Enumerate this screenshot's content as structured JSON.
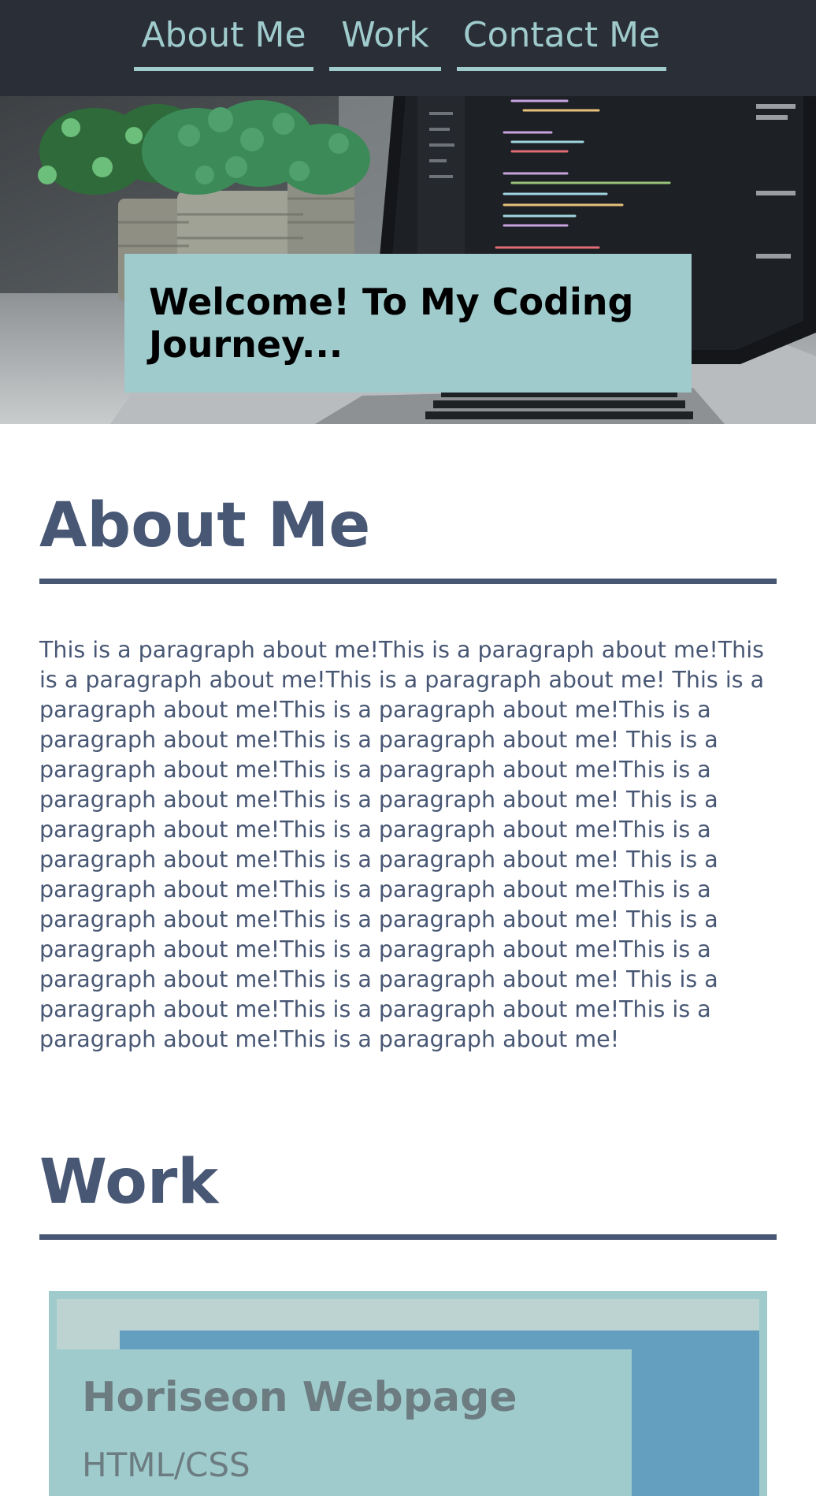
{
  "nav": {
    "about": "About Me",
    "work": "Work",
    "contact": "Contact Me"
  },
  "hero": {
    "title": "Welcome! To My Coding Journey...",
    "image_icon": "laptop-with-plants-photo"
  },
  "about": {
    "heading": "About Me",
    "paragraph": "This is a paragraph about me!This is a paragraph about me!This is a paragraph about me!This is a paragraph about me! This is a paragraph about me!This is a paragraph about me!This is a paragraph about me!This is a paragraph about me! This is a paragraph about me!This is a paragraph about me!This is a paragraph about me!This is a paragraph about me! This is a paragraph about me!This is a paragraph about me!This is a paragraph about me!This is a paragraph about me! This is a paragraph about me!This is a paragraph about me!This is a paragraph about me!This is a paragraph about me! This is a paragraph about me!This is a paragraph about me!This is a paragraph about me!This is a paragraph about me! This is a paragraph about me!This is a paragraph about me!This is a paragraph about me!This is a paragraph about me!"
  },
  "work": {
    "heading": "Work",
    "projects": [
      {
        "title": "Horiseon Webpage",
        "tech": "HTML/CSS"
      }
    ]
  },
  "colors": {
    "nav_bg": "#2a2e37",
    "accent": "#9fcbcd",
    "heading": "#485774",
    "card_text": "#6c7c80"
  }
}
